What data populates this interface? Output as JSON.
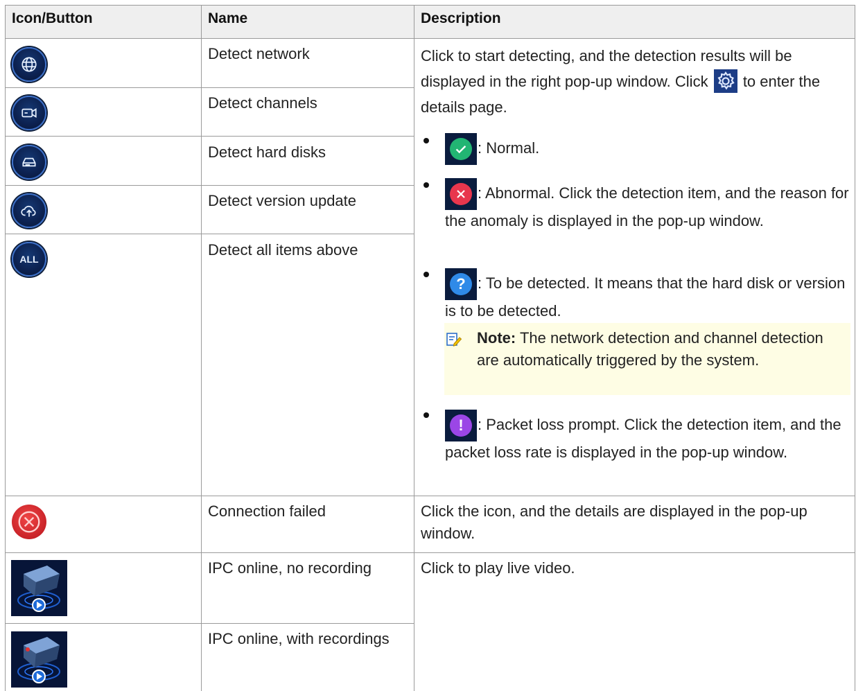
{
  "table": {
    "headers": {
      "icon": "Icon/Button",
      "name": "Name",
      "description": "Description"
    },
    "rows": [
      {
        "icon": "globe-icon",
        "name": "Detect network"
      },
      {
        "icon": "video-camera-icon",
        "name": "Detect channels"
      },
      {
        "icon": "hard-disk-icon",
        "name": "Detect hard disks"
      },
      {
        "icon": "cloud-upload-icon",
        "name": "Detect version update"
      },
      {
        "icon": "all-icon",
        "icon_text": "ALL",
        "name": "Detect all items above"
      },
      {
        "icon": "connection-failed-icon",
        "name": "Connection failed",
        "description": "Click the icon, and the details are displayed in the pop-up window."
      },
      {
        "icon": "ipc-online-no-recording-icon",
        "name": "IPC online, no recording",
        "description": "Click to play live video."
      },
      {
        "icon": "ipc-online-with-recordings-icon",
        "name": "IPC online, with recordings"
      }
    ],
    "detect_description": {
      "intro_before_gear": "Click to start detecting, and the detection results will be displayed in the right pop-up window. Click",
      "intro_after_gear": "to enter the details page.",
      "gear_icon": "gear-icon",
      "statuses": [
        {
          "icon": "check-icon",
          "color": "#22b573",
          "text": ": Normal."
        },
        {
          "icon": "cross-icon",
          "color": "#e8364d",
          "text": ": Abnormal. Click the detection item, and the reason for the anomaly is displayed in the pop-up window."
        },
        {
          "icon": "question-icon",
          "color": "#2f8ae8",
          "text": ": To be detected. It means that the hard disk or version is to be detected."
        },
        {
          "icon": "exclamation-icon",
          "color": "#9b46e6",
          "text": ": Packet loss prompt. Click the detection item, and the packet loss rate is displayed in the pop-up window."
        }
      ],
      "note": {
        "label": "Note:",
        "text": "The network detection and channel detection are automatically triggered by the system."
      }
    }
  },
  "colors": {
    "header_bg": "#efefef",
    "border": "#9a9a9a",
    "note_bg": "#fefde4",
    "icon_bg": "#0c2150"
  }
}
